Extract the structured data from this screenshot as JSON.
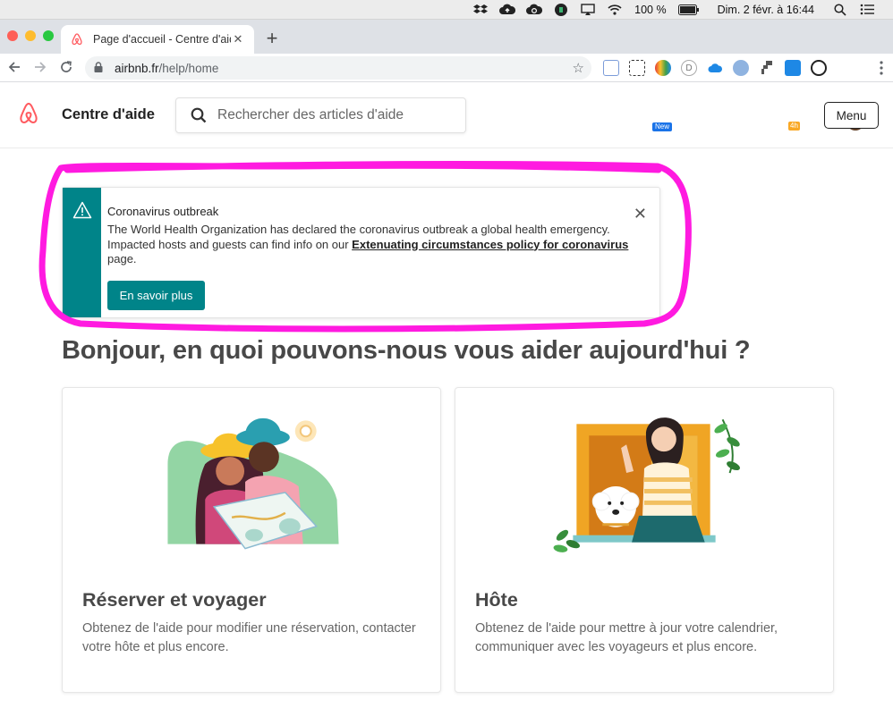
{
  "menubar": {
    "battery": "100 %",
    "datetime": "Dim. 2 févr. à  16:44"
  },
  "browser": {
    "tab_title": "Page d'accueil - Centre d'aide",
    "tab_close": "✕",
    "new_tab": "+",
    "url_host": "airbnb.fr",
    "url_path": "/help/home",
    "ext_badge_new": "New",
    "ext_badge_4h": "4h",
    "ext_d": "D"
  },
  "header": {
    "brand": "Centre d'aide",
    "search_placeholder": "Rechercher des articles d'aide",
    "menu_label": "Menu"
  },
  "alert": {
    "title": "Coronavirus outbreak",
    "text_before": "The World Health Organization has declared the coronavirus outbreak a global health emergency. Impacted hosts and guests can find info on our ",
    "link": "Extenuating circumstances policy for coronavirus",
    "text_after": " page.",
    "button": "En savoir plus",
    "close": "✕"
  },
  "main": {
    "heading": "Bonjour, en quoi pouvons-nous vous aider aujourd'hui ?",
    "cards": [
      {
        "title": "Réserver et voyager",
        "desc": "Obtenez de l'aide pour modifier une réservation, contacter votre hôte et plus encore."
      },
      {
        "title": "Hôte",
        "desc": "Obtenez de l'aide pour mettre à jour votre calendrier, communiquer avec les voyageurs et plus encore."
      }
    ]
  },
  "colors": {
    "brand": "#FF5A5F",
    "teal": "#008489",
    "highlight": "#FF1AE0"
  }
}
